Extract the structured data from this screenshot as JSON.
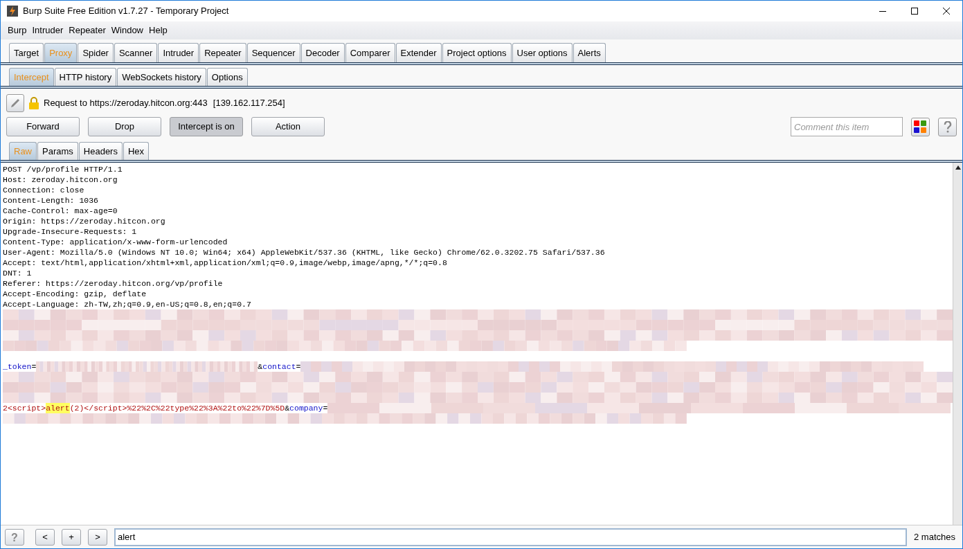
{
  "window": {
    "title": "Burp Suite Free Edition v1.7.27 - Temporary Project"
  },
  "menu": [
    "Burp",
    "Intruder",
    "Repeater",
    "Window",
    "Help"
  ],
  "main_tabs": [
    {
      "label": "Target",
      "selected": false
    },
    {
      "label": "Proxy",
      "selected": true
    },
    {
      "label": "Spider",
      "selected": false
    },
    {
      "label": "Scanner",
      "selected": false
    },
    {
      "label": "Intruder",
      "selected": false
    },
    {
      "label": "Repeater",
      "selected": false
    },
    {
      "label": "Sequencer",
      "selected": false
    },
    {
      "label": "Decoder",
      "selected": false
    },
    {
      "label": "Comparer",
      "selected": false
    },
    {
      "label": "Extender",
      "selected": false
    },
    {
      "label": "Project options",
      "selected": false
    },
    {
      "label": "User options",
      "selected": false
    },
    {
      "label": "Alerts",
      "selected": false
    }
  ],
  "proxy_tabs": [
    {
      "label": "Intercept",
      "selected": true
    },
    {
      "label": "HTTP history",
      "selected": false
    },
    {
      "label": "WebSockets history",
      "selected": false
    },
    {
      "label": "Options",
      "selected": false
    }
  ],
  "request": {
    "label": "Request to https://zeroday.hitcon.org:443",
    "address": "[139.162.117.254]"
  },
  "buttons": [
    {
      "label": "Forward",
      "pressed": false
    },
    {
      "label": "Drop",
      "pressed": false
    },
    {
      "label": "Intercept is on",
      "pressed": true
    },
    {
      "label": "Action",
      "pressed": false
    }
  ],
  "comment": {
    "placeholder": "Comment this item"
  },
  "view_tabs": [
    {
      "label": "Raw",
      "selected": true
    },
    {
      "label": "Params",
      "selected": false
    },
    {
      "label": "Headers",
      "selected": false
    },
    {
      "label": "Hex",
      "selected": false
    }
  ],
  "body": [
    {
      "kind": "text",
      "text": "POST /vp/profile HTTP/1.1"
    },
    {
      "kind": "text",
      "text": "Host: zeroday.hitcon.org"
    },
    {
      "kind": "text",
      "text": "Connection: close"
    },
    {
      "kind": "text",
      "text": "Content-Length: 1036"
    },
    {
      "kind": "text",
      "text": "Cache-Control: max-age=0"
    },
    {
      "kind": "text",
      "text": "Origin: https://zeroday.hitcon.org"
    },
    {
      "kind": "text",
      "text": "Upgrade-Insecure-Requests: 1"
    },
    {
      "kind": "text",
      "text": "Content-Type: application/x-www-form-urlencoded"
    },
    {
      "kind": "text",
      "text": "User-Agent: Mozilla/5.0 (Windows NT 10.0; Win64; x64) AppleWebKit/537.36 (KHTML, like Gecko) Chrome/62.0.3202.75 Safari/537.36"
    },
    {
      "kind": "text",
      "text": "Accept: text/html,application/xhtml+xml,application/xml;q=0.9,image/webp,image/apng,*/*;q=0.8"
    },
    {
      "kind": "text",
      "text": "DNT: 1"
    },
    {
      "kind": "text",
      "text": "Referer: https://zeroday.hitcon.org/vp/profile"
    },
    {
      "kind": "text",
      "text": "Accept-Encoding: gzip, deflate"
    },
    {
      "kind": "text",
      "text": "Accept-Language: zh-TW,zh;q=0.9,en-US;q=0.8,en;q=0.7"
    },
    {
      "kind": "redacted",
      "short": false
    },
    {
      "kind": "redacted",
      "short": false
    },
    {
      "kind": "redacted",
      "short": false
    },
    {
      "kind": "redacted",
      "short": true
    },
    {
      "kind": "blank"
    },
    {
      "kind": "params",
      "segments": [
        {
          "kind": "name",
          "text": "_token"
        },
        {
          "kind": "symbol",
          "text": "="
        },
        {
          "kind": "redacted"
        },
        {
          "kind": "symbol",
          "text": "&"
        },
        {
          "kind": "name",
          "text": "contact"
        },
        {
          "kind": "symbol",
          "text": "="
        },
        {
          "kind": "redacted"
        }
      ]
    },
    {
      "kind": "redacted",
      "short": false
    },
    {
      "kind": "redacted",
      "short": false
    },
    {
      "kind": "redacted",
      "short": false
    },
    {
      "kind": "params",
      "segments": [
        {
          "kind": "value",
          "text": "2<script>"
        },
        {
          "kind": "match",
          "text": "alert"
        },
        {
          "kind": "value",
          "text": "(2)</script>%22%2C%22type%22%3A%22to%22%7D%5D"
        },
        {
          "kind": "symbol",
          "text": "&"
        },
        {
          "kind": "name",
          "text": "company"
        },
        {
          "kind": "symbol",
          "text": "="
        },
        {
          "kind": "redacted"
        }
      ]
    },
    {
      "kind": "redacted",
      "short": true
    }
  ],
  "search": {
    "buttons": [
      "?",
      "<",
      "+",
      ">"
    ],
    "value": "alert",
    "matches": "2 matches"
  }
}
